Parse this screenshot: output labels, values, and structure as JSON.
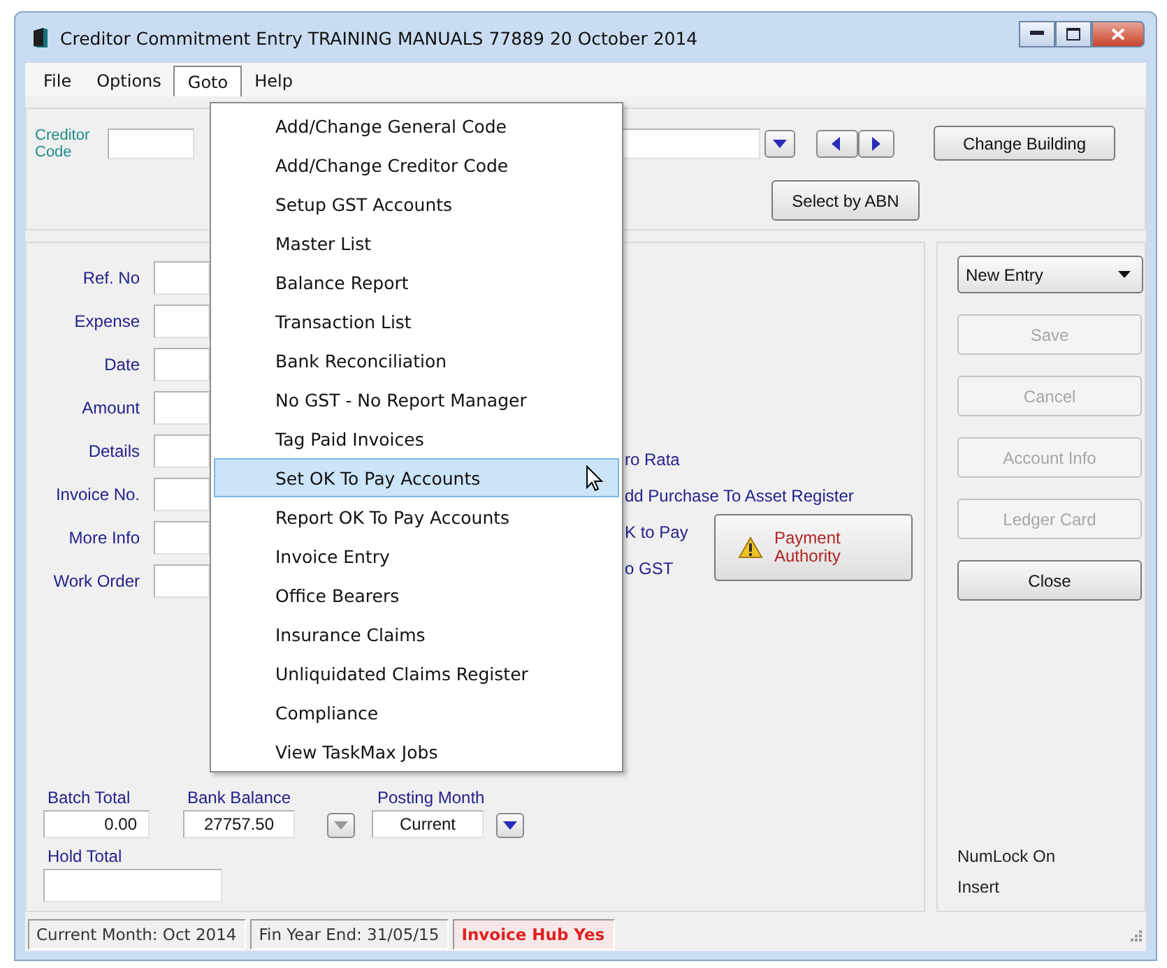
{
  "window": {
    "title": "Creditor Commitment Entry TRAINING MANUALS 77889 20 October 2014"
  },
  "menu_bar": [
    {
      "label": "File",
      "selected": false
    },
    {
      "label": "Options",
      "selected": false
    },
    {
      "label": "Goto",
      "selected": true
    },
    {
      "label": "Help",
      "selected": false
    }
  ],
  "goto_menu": [
    {
      "label": "Add/Change General Code",
      "selected": false
    },
    {
      "label": "Add/Change Creditor Code",
      "selected": false
    },
    {
      "label": "Setup GST Accounts",
      "selected": false
    },
    {
      "label": "Master List",
      "selected": false
    },
    {
      "label": "Balance Report",
      "selected": false
    },
    {
      "label": "Transaction List",
      "selected": false
    },
    {
      "label": "Bank Reconciliation",
      "selected": false
    },
    {
      "label": "No GST - No Report Manager",
      "selected": false
    },
    {
      "label": "Tag Paid Invoices",
      "selected": false
    },
    {
      "label": "Set OK To Pay Accounts",
      "selected": true
    },
    {
      "label": "Report OK To Pay Accounts",
      "selected": false
    },
    {
      "label": "Invoice Entry",
      "selected": false
    },
    {
      "label": "Office Bearers",
      "selected": false
    },
    {
      "label": "Insurance Claims",
      "selected": false
    },
    {
      "label": "Unliquidated Claims Register",
      "selected": false
    },
    {
      "label": "Compliance",
      "selected": false
    },
    {
      "label": "View TaskMax Jobs",
      "selected": false
    }
  ],
  "creditor": {
    "label": "Creditor Code"
  },
  "top_buttons": {
    "change_building": "Change Building",
    "select_by_abn": "Select by ABN"
  },
  "form_fields": [
    {
      "label": "Ref. No"
    },
    {
      "label": "Expense"
    },
    {
      "label": "Date"
    },
    {
      "label": "Amount"
    },
    {
      "label": "Details"
    },
    {
      "label": "Invoice No."
    },
    {
      "label": "More Info"
    },
    {
      "label": "Work Order"
    }
  ],
  "options": [
    "ro Rata",
    "dd Purchase To Asset Register",
    "K to Pay",
    "o GST"
  ],
  "payment_authority": "Payment Authority",
  "entry_mode": {
    "value": "New Entry"
  },
  "actions": [
    {
      "label": "Save",
      "disabled": true
    },
    {
      "label": "Cancel",
      "disabled": true
    },
    {
      "label": "Account Info",
      "disabled": true
    },
    {
      "label": "Ledger Card",
      "disabled": true
    },
    {
      "label": "Close",
      "disabled": false
    }
  ],
  "totals": {
    "batch_total": {
      "label": "Batch Total",
      "value": "0.00"
    },
    "bank_balance": {
      "label": "Bank Balance",
      "value": "27757.50"
    },
    "posting_month": {
      "label": "Posting Month",
      "value": "Current"
    },
    "hold_total": {
      "label": "Hold Total"
    }
  },
  "keyboard_status": [
    "NumLock On",
    "Insert"
  ],
  "status_bar": [
    {
      "text": "Current Month: Oct 2014",
      "kind": "plain"
    },
    {
      "text": "Fin Year End: 31/05/15",
      "kind": "plain"
    },
    {
      "text": "Invoice Hub Yes",
      "kind": "alert"
    }
  ]
}
